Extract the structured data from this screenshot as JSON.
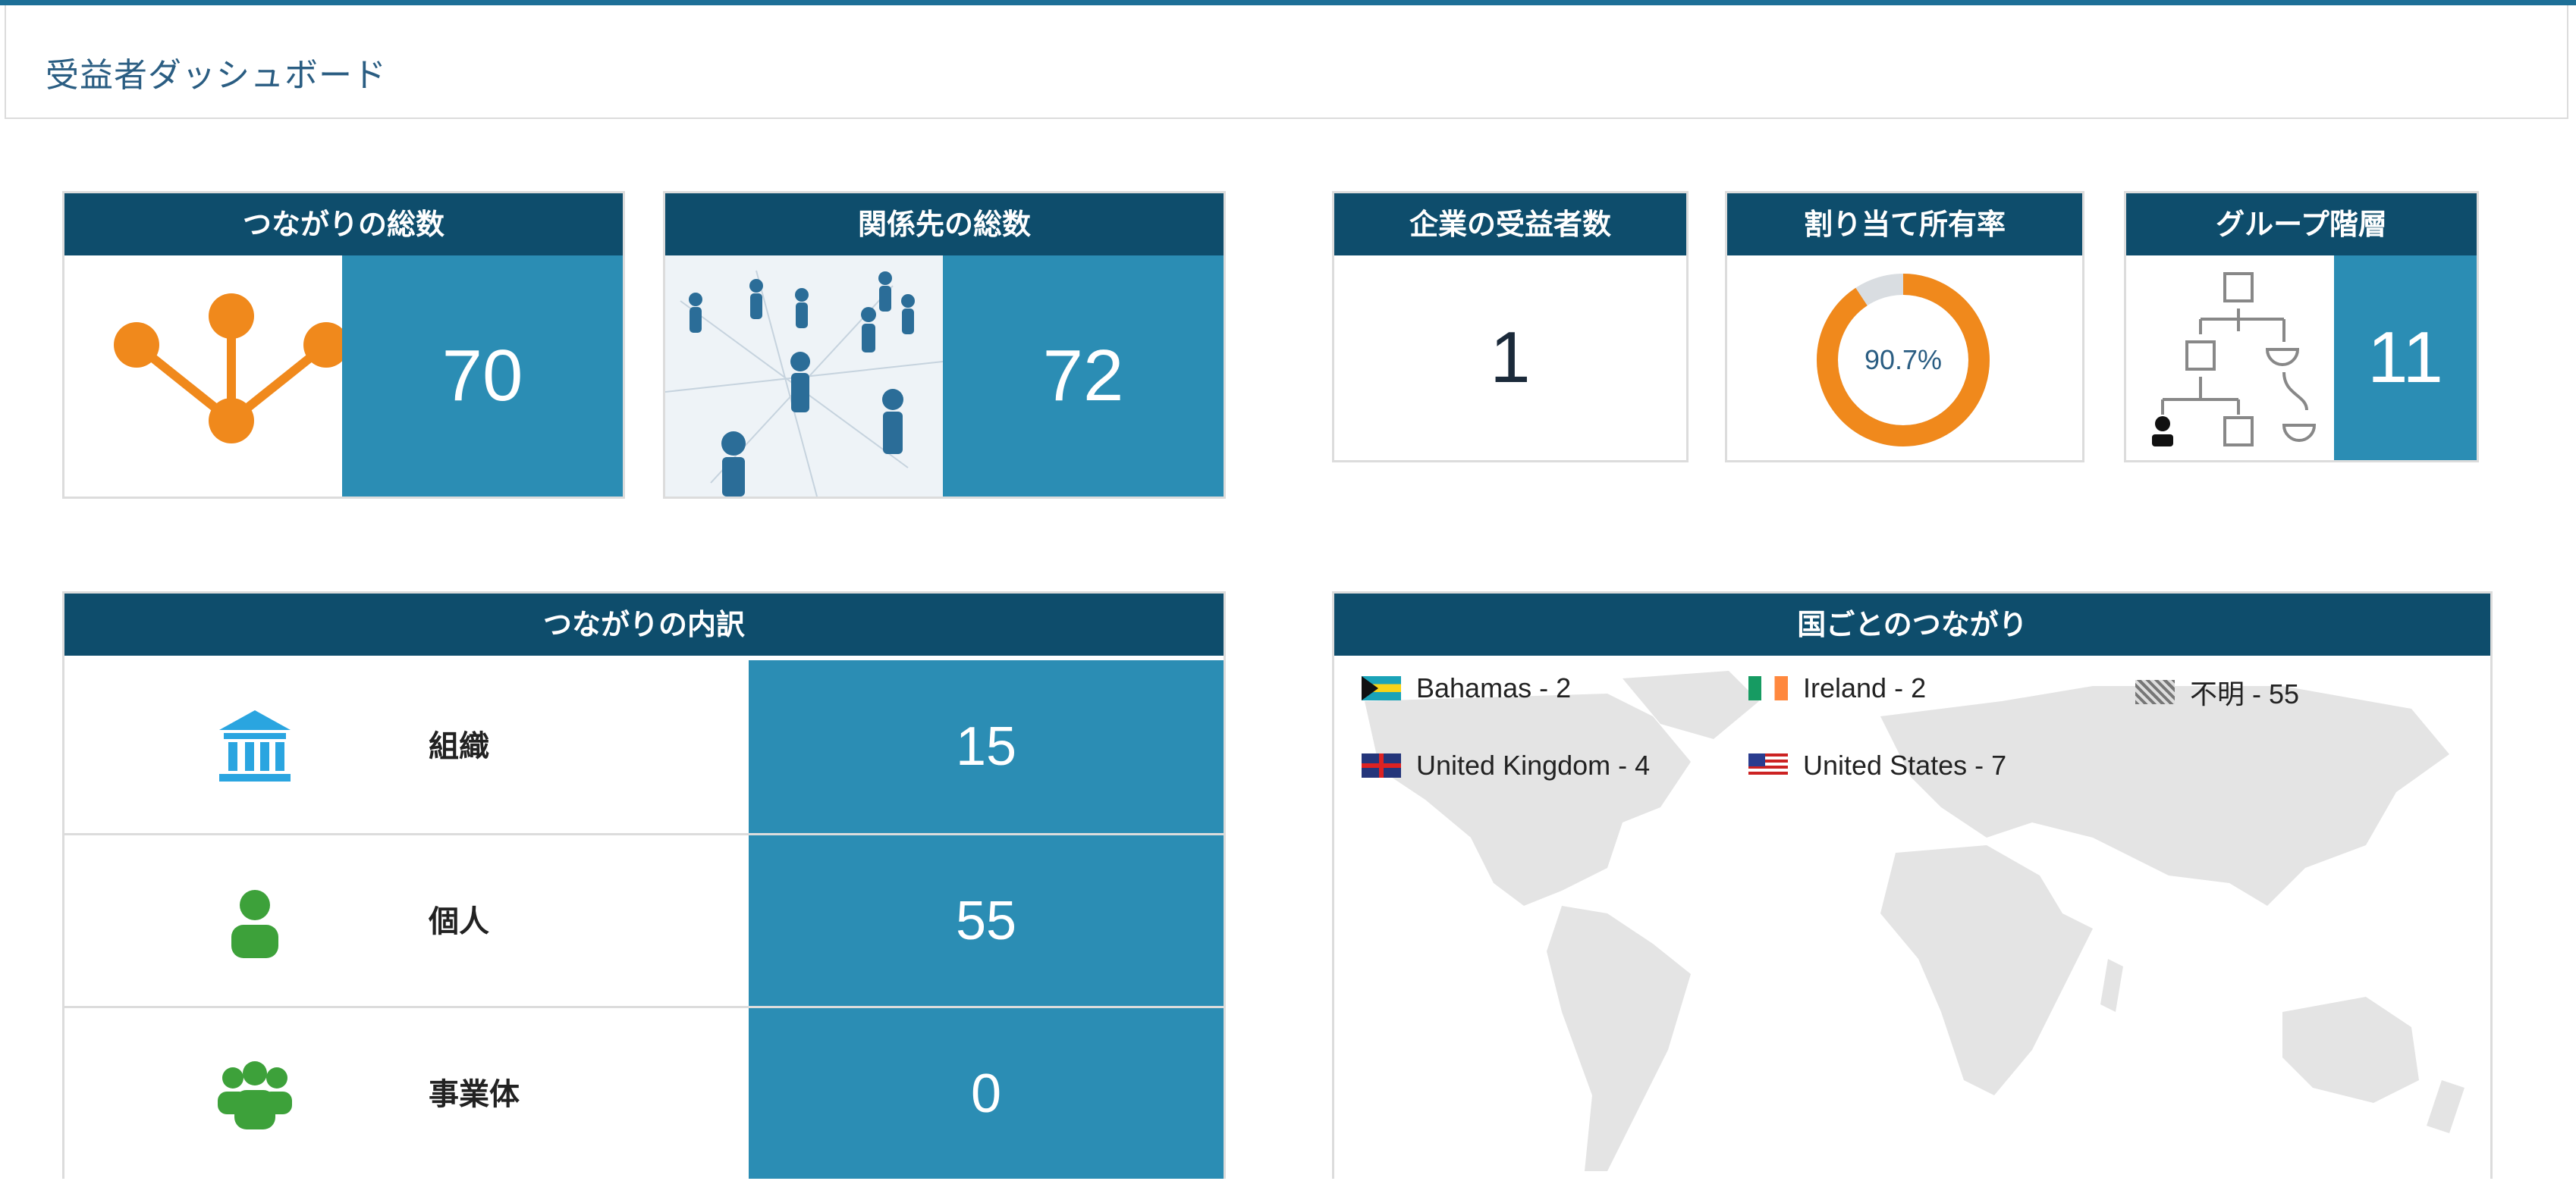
{
  "page": {
    "title": "受益者ダッシュボード"
  },
  "cards": {
    "connections_total": {
      "title": "つながりの総数",
      "value": "70"
    },
    "relations_total": {
      "title": "関係先の総数",
      "value": "72"
    },
    "corporate_beneficiaries": {
      "title": "企業の受益者数",
      "value": "1"
    },
    "allocated_ownership": {
      "title": "割り当て所有率",
      "value": "90.7%",
      "percent": 90.7,
      "color": "#f0891c"
    },
    "group_hierarchy": {
      "title": "グループ階層",
      "value": "11"
    }
  },
  "breakdown": {
    "title": "つながりの内訳",
    "rows": [
      {
        "label": "組織",
        "value": "15",
        "icon": "bank-icon"
      },
      {
        "label": "個人",
        "value": "55",
        "icon": "person-icon"
      },
      {
        "label": "事業体",
        "value": "0",
        "icon": "group-icon"
      }
    ]
  },
  "countries": {
    "title": "国ごとのつながり",
    "legend": [
      {
        "label": "Bahamas - 2",
        "icon": "bahamas-flag-icon"
      },
      {
        "label": "Ireland - 2",
        "icon": "ireland-flag-icon"
      },
      {
        "label": "不明 - 55",
        "icon": "unknown-flag-icon"
      },
      {
        "label": "United Kingdom - 4",
        "icon": "uk-flag-icon"
      },
      {
        "label": "United States - 7",
        "icon": "us-flag-icon"
      }
    ]
  },
  "colors": {
    "header": "#0e4d6c",
    "value_bg": "#2b8db4",
    "accent": "#f0891c"
  }
}
